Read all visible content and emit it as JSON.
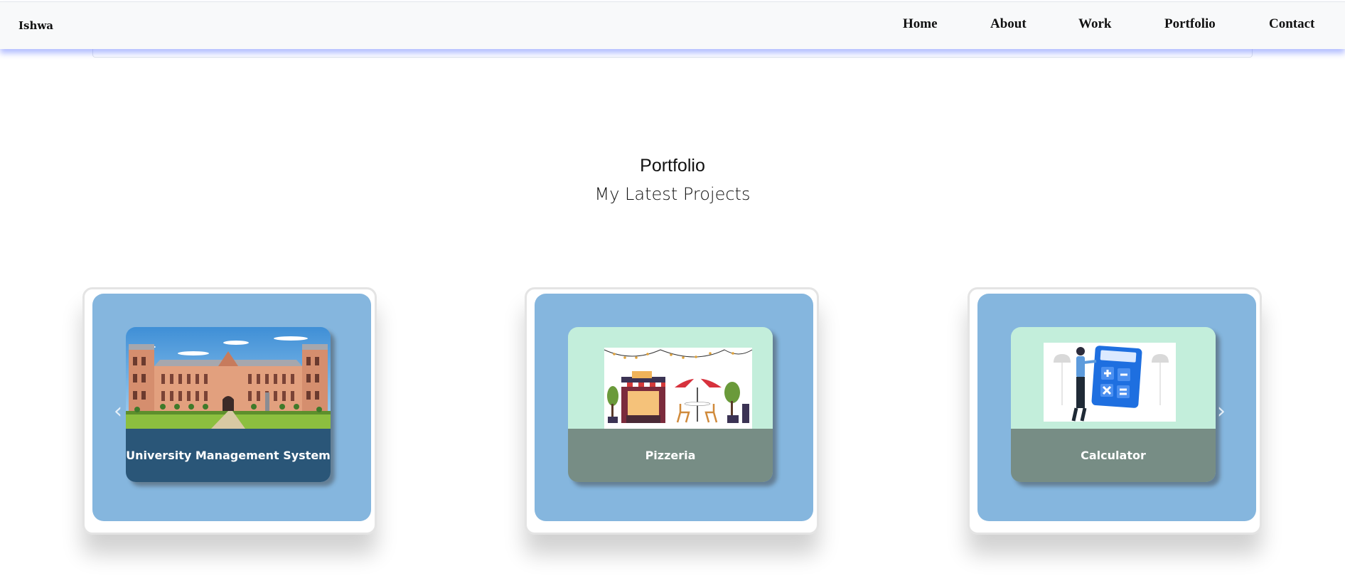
{
  "navbar": {
    "brand": "Ishwa",
    "links": [
      "Home",
      "About",
      "Work",
      "Portfolio",
      "Contact"
    ]
  },
  "portfolio": {
    "title": "Portfolio",
    "subtitle": "My Latest Projects",
    "projects": [
      {
        "name": "University Management System",
        "image": "university-building-illustration",
        "caption_color": "#2a5678"
      },
      {
        "name": "Pizzeria",
        "image": "cafe-storefront-illustration",
        "caption_color": "#778d85"
      },
      {
        "name": "Calculator",
        "image": "person-with-calculator-illustration",
        "caption_color": "#778d85"
      }
    ],
    "prev_icon": "chevron-left-icon",
    "next_icon": "chevron-right-icon"
  },
  "colors": {
    "card_background": "#85b6de",
    "thumb_background": "#c3eedb",
    "nav_shadow": "#586eff"
  }
}
